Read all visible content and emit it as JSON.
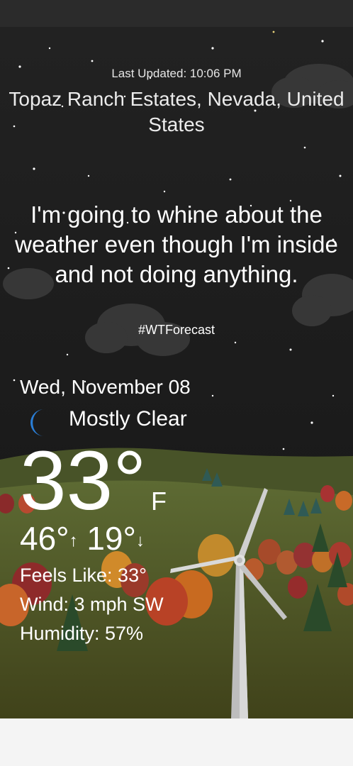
{
  "header": {
    "last_updated": "Last Updated: 10:06 PM",
    "location": "Topaz Ranch Estates, Nevada, United States"
  },
  "forecast": {
    "quip": "I'm going to whine about the weather even though I'm inside and not doing anything.",
    "hashtag": "#WTForecast"
  },
  "current": {
    "date": "Wed, November 08",
    "condition_icon": "crescent-moon-icon",
    "condition": "Mostly Clear",
    "temperature": "33°",
    "unit": "F",
    "high": "46°",
    "low": "19°",
    "feels_like": "Feels Like:  33°",
    "wind": "Wind:  3 mph SW",
    "humidity": "Humidity:  57%"
  },
  "colors": {
    "sky": "#1d1d1d",
    "moon": "#2a7ed6",
    "hill": "#56642e",
    "text": "#ffffff"
  }
}
